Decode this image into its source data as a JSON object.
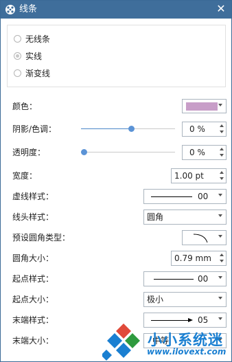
{
  "window": {
    "title": "线条",
    "title_icon": "palette-icon",
    "close_glyph": "✕"
  },
  "line_type": {
    "options": [
      {
        "label": "无线条",
        "selected": false
      },
      {
        "label": "实线",
        "selected": true
      },
      {
        "label": "渐变线",
        "selected": false
      }
    ]
  },
  "props": {
    "color": {
      "label": "颜色：",
      "value": "#c89ec8"
    },
    "shadow": {
      "label": "阴影/色调：",
      "value": "0 %",
      "slider_level": 0.5
    },
    "transparency": {
      "label": "透明度：",
      "value": "0 %",
      "slider_level": 0.0
    },
    "width": {
      "label": "宽度：",
      "value": "1.00 pt"
    },
    "dash": {
      "label": "虚线样式：",
      "value": "00"
    },
    "cap": {
      "label": "线头样式：",
      "value": "圆角"
    },
    "corner_type": {
      "label": "预设圆角类型："
    },
    "corner_size": {
      "label": "圆角大小：",
      "value": "0.79 mm"
    },
    "start_style": {
      "label": "起点样式：",
      "value": "00"
    },
    "start_size": {
      "label": "起点大小：",
      "value": "极小"
    },
    "end_style": {
      "label": "末端样式：",
      "value": "05"
    },
    "end_size": {
      "label": "末端大小：",
      "value": "中等"
    }
  },
  "watermark": {
    "text": "小小系统迷",
    "url": "www.ilovext.com"
  },
  "colors": {
    "titlebar": "#3f6e9b",
    "accent": "#5b93d6",
    "swatch": "#c89ec8"
  }
}
